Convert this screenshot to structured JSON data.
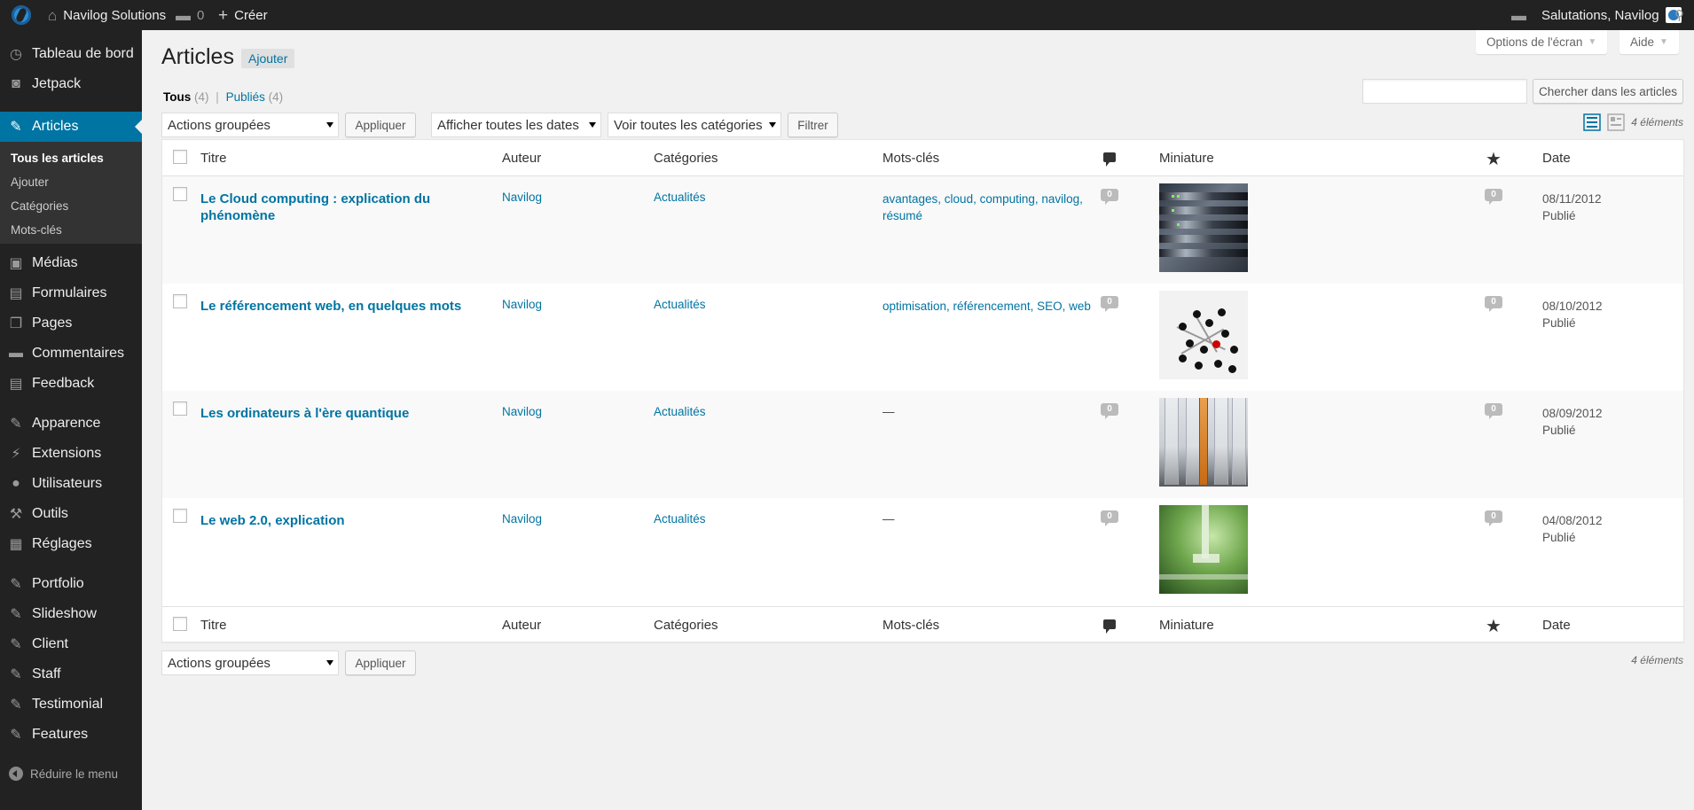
{
  "adminbar": {
    "site_name": "Navilog Solutions",
    "comments_count": "0",
    "new_label": "Créer",
    "greeting": "Salutations, Navilog"
  },
  "sidebar": {
    "items": [
      {
        "label": "Tableau de bord",
        "icon": "dashboard-icon"
      },
      {
        "label": "Jetpack",
        "icon": "jetpack-icon"
      },
      {
        "label": "Articles",
        "icon": "pin-icon"
      },
      {
        "label": "Médias",
        "icon": "media-icon"
      },
      {
        "label": "Formulaires",
        "icon": "forms-icon"
      },
      {
        "label": "Pages",
        "icon": "pages-icon"
      },
      {
        "label": "Commentaires",
        "icon": "comments-icon"
      },
      {
        "label": "Feedback",
        "icon": "feedback-icon"
      },
      {
        "label": "Apparence",
        "icon": "brush-icon"
      },
      {
        "label": "Extensions",
        "icon": "plugin-icon"
      },
      {
        "label": "Utilisateurs",
        "icon": "users-icon"
      },
      {
        "label": "Outils",
        "icon": "tools-icon"
      },
      {
        "label": "Réglages",
        "icon": "settings-icon"
      },
      {
        "label": "Portfolio",
        "icon": "pin-icon"
      },
      {
        "label": "Slideshow",
        "icon": "pin-icon"
      },
      {
        "label": "Client",
        "icon": "pin-icon"
      },
      {
        "label": "Staff",
        "icon": "pin-icon"
      },
      {
        "label": "Testimonial",
        "icon": "pin-icon"
      },
      {
        "label": "Features",
        "icon": "pin-icon"
      }
    ],
    "submenu": [
      "Tous les articles",
      "Ajouter",
      "Catégories",
      "Mots-clés"
    ],
    "collapse_label": "Réduire le menu"
  },
  "screen": {
    "options_label": "Options de l'écran",
    "help_label": "Aide"
  },
  "page": {
    "title": "Articles",
    "add_new": "Ajouter",
    "views": {
      "all_label": "Tous",
      "all_count": "(4)",
      "separator": "|",
      "published_label": "Publiés",
      "published_count": "(4)"
    },
    "search_button": "Chercher dans les articles",
    "search_value": "",
    "bulk_actions": "Actions groupées",
    "apply": "Appliquer",
    "date_filter": "Afficher toutes les dates",
    "category_filter": "Voir toutes les catégories",
    "filter": "Filtrer",
    "items_count": "4 éléments"
  },
  "table": {
    "columns": {
      "title": "Titre",
      "author": "Auteur",
      "categories": "Catégories",
      "tags": "Mots-clés",
      "thumbnail": "Miniature",
      "date": "Date"
    },
    "rows": [
      {
        "title": "Le Cloud computing : explication du phénomène",
        "author": "Navilog",
        "category": "Actualités",
        "tags": "avantages, cloud, computing, navilog, résumé",
        "comments": "0",
        "likes": "0",
        "date": "08/11/2012",
        "status": "Publié",
        "thumbnail": "server-rack"
      },
      {
        "title": "Le référencement web, en quelques mots",
        "author": "Navilog",
        "category": "Actualités",
        "tags": "optimisation, référencement, SEO, web",
        "comments": "0",
        "likes": "0",
        "date": "08/10/2012",
        "status": "Publié",
        "thumbnail": "molecule"
      },
      {
        "title": "Les ordinateurs à l'ère quantique",
        "author": "Navilog",
        "category": "Actualités",
        "tags": "—",
        "comments": "0",
        "likes": "0",
        "date": "08/09/2012",
        "status": "Publié",
        "thumbnail": "lab-tubes"
      },
      {
        "title": "Le web 2.0, explication",
        "author": "Navilog",
        "category": "Actualités",
        "tags": "—",
        "comments": "0",
        "likes": "0",
        "date": "04/08/2012",
        "status": "Publié",
        "thumbnail": "green-machine"
      }
    ]
  },
  "colors": {
    "accent": "#0074a2",
    "sidebar_bg": "#222222",
    "adminbar_bg": "#222222",
    "background": "#f1f1f1"
  }
}
